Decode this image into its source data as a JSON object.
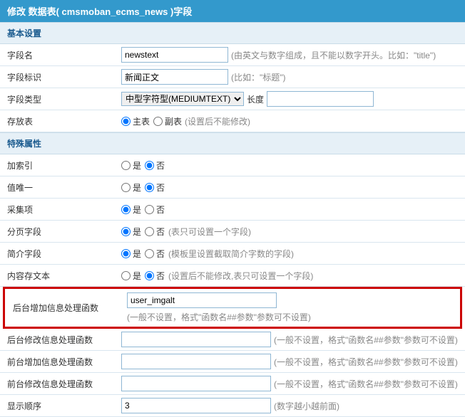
{
  "header": "修改 数据表( cmsmoban_ecms_news )字段",
  "sections": {
    "basic": "基本设置",
    "special": "特殊属性"
  },
  "rows": {
    "fieldname": {
      "label": "字段名",
      "value": "newstext",
      "hint": "(由英文与数字组成，且不能以数字开头。比如：\"title\")"
    },
    "fieldident": {
      "label": "字段标识",
      "value": "新闻正文",
      "hint": "(比如：\"标题\")"
    },
    "fieldtype": {
      "label": "字段类型",
      "value": "中型字符型(MEDIUMTEXT)",
      "len_label": "长度",
      "len_value": ""
    },
    "storagetable": {
      "label": "存放表",
      "opt1": "主表",
      "opt2": "副表",
      "hint": "(设置后不能修改)"
    },
    "addindex": {
      "label": "加索引"
    },
    "unique": {
      "label": "值唯一"
    },
    "collect": {
      "label": "采集项"
    },
    "pagefield": {
      "label": "分页字段",
      "yes": "是",
      "no": "否",
      "hint": "(表只可设置一个字段)"
    },
    "intro": {
      "label": "简介字段",
      "yes": "是",
      "no": "否",
      "hint": "(模板里设置截取简介字数的字段)"
    },
    "contenttext": {
      "label": "内容存文本",
      "yes": "是",
      "no": "否",
      "hint": "(设置后不能修改,表只可设置一个字段)"
    },
    "addfunc_post": {
      "label": "后台增加信息处理函数",
      "value": "user_imgalt",
      "hint": "(一般不设置，格式\"函数名##参数\"参数可不设置)"
    },
    "editfunc_post": {
      "label": "后台修改信息处理函数",
      "value": "",
      "hint": "(一般不设置，格式\"函数名##参数\"参数可不设置)"
    },
    "addfunc_front": {
      "label": "前台增加信息处理函数",
      "value": "",
      "hint": "(一般不设置，格式\"函数名##参数\"参数可不设置)"
    },
    "editfunc_front": {
      "label": "前台修改信息处理函数",
      "value": "",
      "hint": "(一般不设置，格式\"函数名##参数\"参数可不设置)"
    },
    "order": {
      "label": "显示顺序",
      "value": "3",
      "hint": "(数字越小越前面)"
    }
  },
  "yesno": {
    "yes": "是",
    "no": "否"
  }
}
